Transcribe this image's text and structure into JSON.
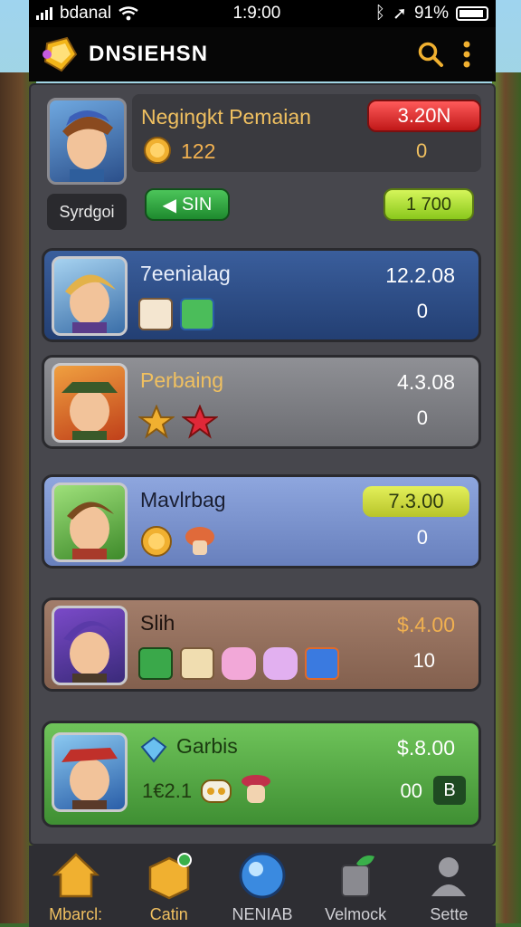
{
  "status_bar": {
    "carrier": "bdanal",
    "time": "1:9:00",
    "battery": "91%"
  },
  "app": {
    "title": "DNSIEHSN"
  },
  "header": {
    "player_name": "Negingkt Pemaian",
    "coins": "122",
    "badge_value": "3.20N",
    "badge_sub": "0",
    "label": "Syrdgoi",
    "green_button": "SIN",
    "lime_button": "1 700"
  },
  "list": [
    {
      "name": "7eenialag",
      "value": "12.2.08",
      "sub": "0"
    },
    {
      "name": "Perbaing",
      "value": "4.3.08",
      "sub": "0"
    },
    {
      "name": "Mavlrbag",
      "value": "7.3.00",
      "sub": "0"
    },
    {
      "name": "Slih",
      "value": "$.4.00",
      "sub": "10"
    },
    {
      "name": "Garbis",
      "value": "$.8.00",
      "sub": "00",
      "extra": "1€2.1",
      "chip": "B"
    }
  ],
  "nav": [
    {
      "label": "Mbarcl:"
    },
    {
      "label": "Catin"
    },
    {
      "label": "NENIAB"
    },
    {
      "label": "Velmock"
    },
    {
      "label": "Sette"
    }
  ],
  "colors": {
    "accent": "#f0c060",
    "danger": "#e02828",
    "success": "#2faa3e",
    "lime": "#b7dc2a"
  }
}
